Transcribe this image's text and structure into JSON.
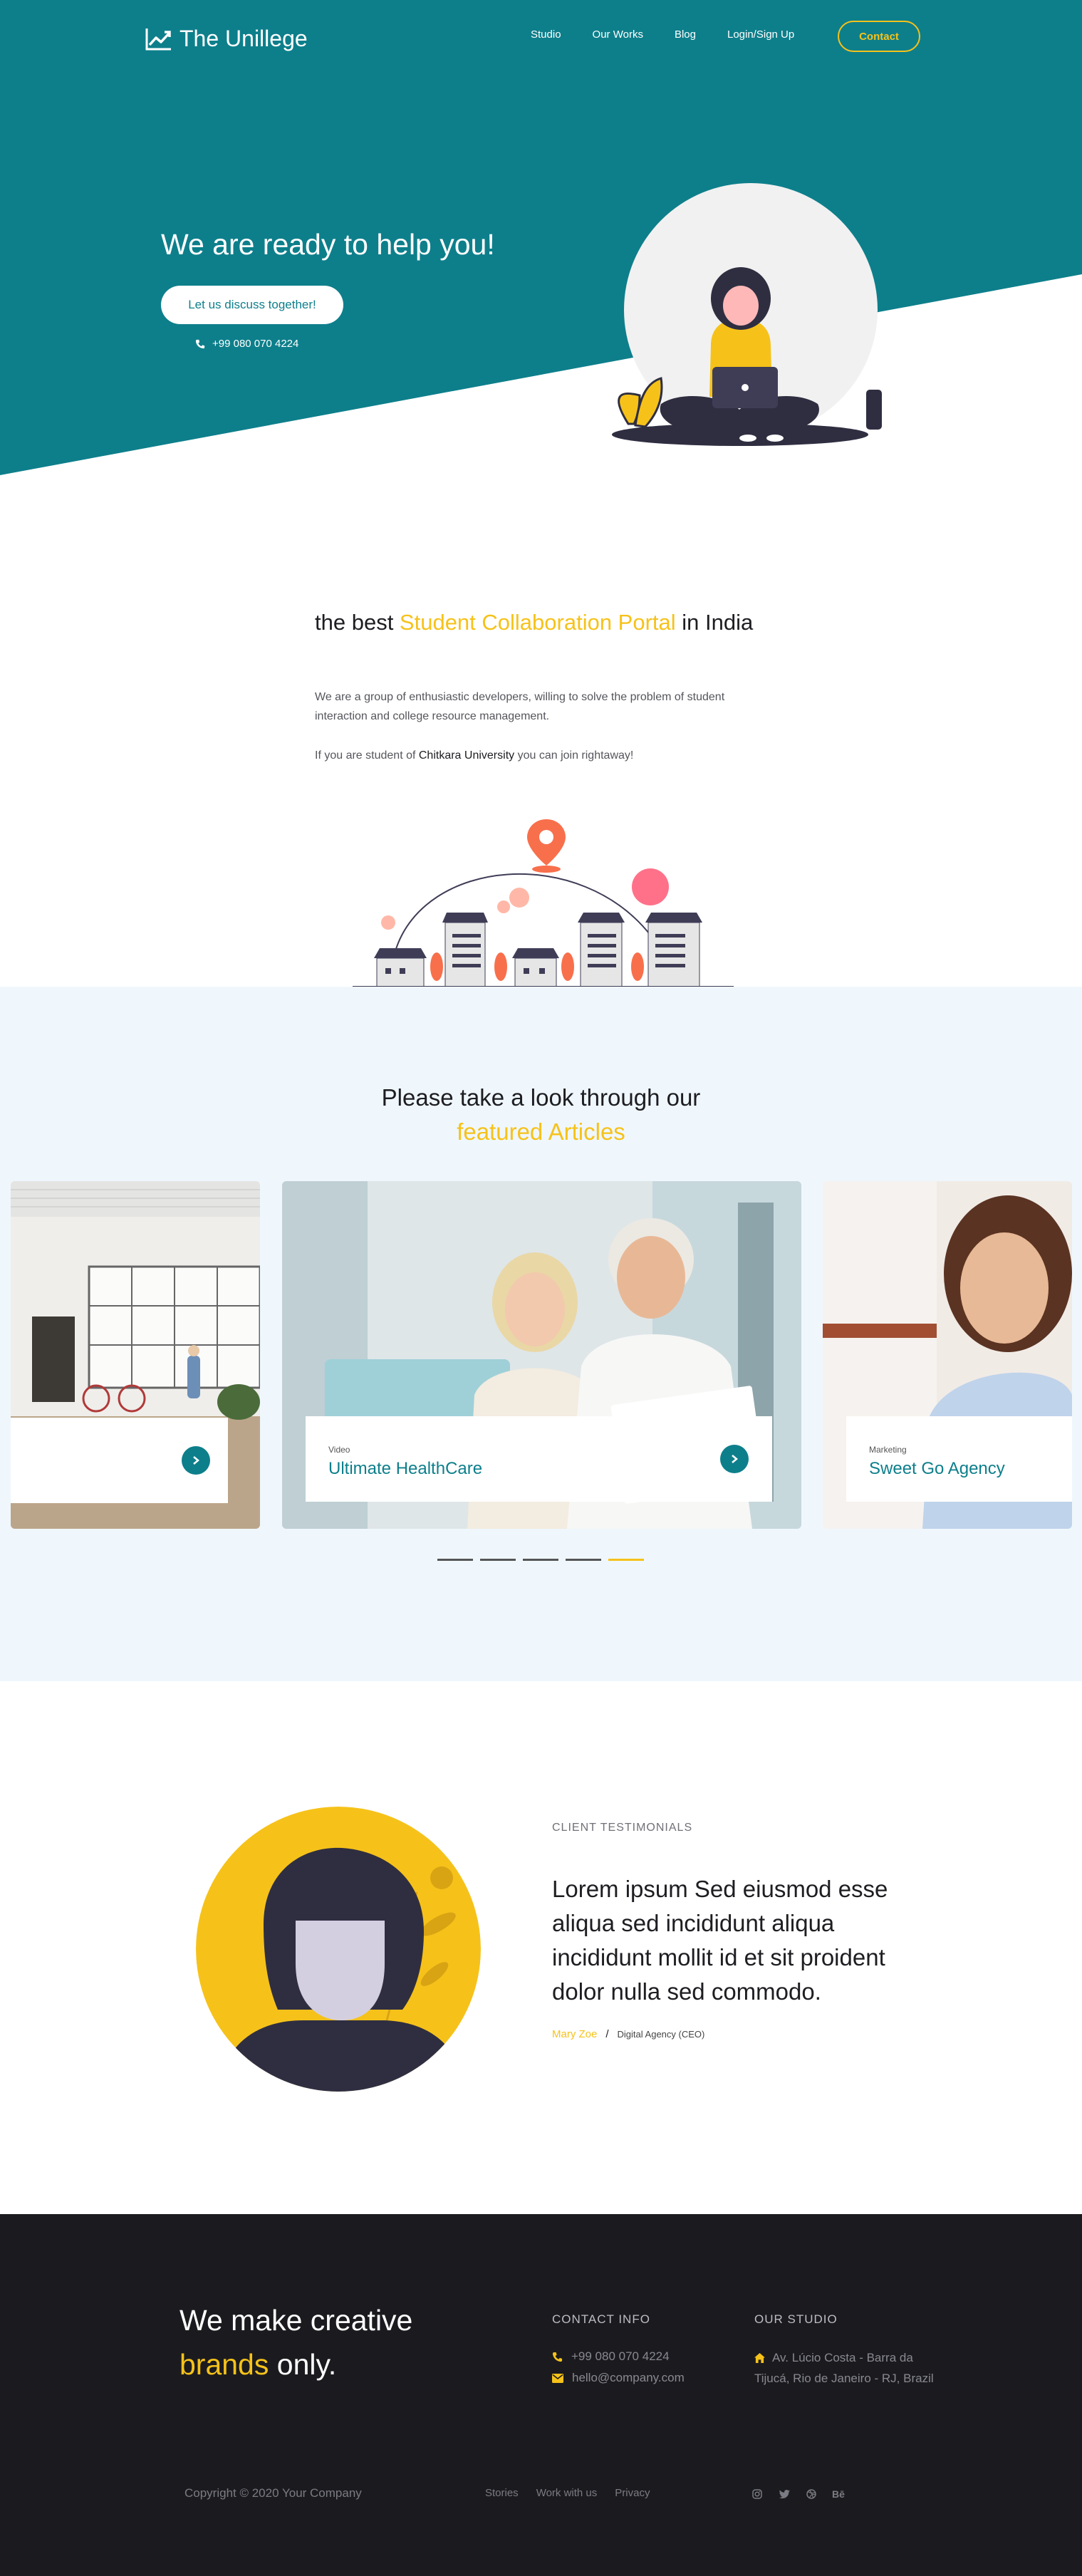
{
  "nav": {
    "logo_text": "The Unillege",
    "links": [
      "Studio",
      "Our Works",
      "Blog",
      "Login/Sign Up"
    ],
    "contact_label": "Contact"
  },
  "hero": {
    "title": "We are ready to help you!",
    "cta_label": "Let us discuss together!",
    "phone": "+99 080 070 4224"
  },
  "about": {
    "title_pre": "the best ",
    "title_accent": "Student Collaboration Portal",
    "title_post": " in India",
    "paragraph": "We are a group of enthusiastic developers, willing to solve the problem of student interaction and college resource management.",
    "join_pre": "If you are student of ",
    "join_bold": "Chitkara University",
    "join_post": " you can join rightaway!"
  },
  "articles": {
    "title_line1": "Please take a look through our",
    "title_line2": "featured Articles",
    "cards": [
      {
        "category": "",
        "title": ""
      },
      {
        "category": "Video",
        "title": "Ultimate HealthCare"
      },
      {
        "category": "Marketing",
        "title": "Sweet Go Agency"
      }
    ],
    "dots_count": 5,
    "active_dot": 4
  },
  "testimonials": {
    "kicker": "CLIENT TESTIMONIALS",
    "quote": "Lorem ipsum Sed eiusmod esse aliqua sed incididunt aliqua incididunt mollit id et sit proident dolor nulla sed commodo.",
    "author": "Mary Zoe",
    "separator": "/",
    "role": "Digital Agency (CEO)"
  },
  "footer": {
    "slogan_line1": "We make creative",
    "slogan_accent": "brands",
    "slogan_post": " only.",
    "contact_title": "CONTACT INFO",
    "phone": "+99 080 070 4224",
    "email": "hello@company.com",
    "studio_title": "OUR STUDIO",
    "address": "Av. Lúcio Costa - Barra da Tijucá, Rio de Janeiro - RJ, Brazil",
    "copyright": "Copyright © 2020 Your Company",
    "links": [
      "Stories",
      "Work with us",
      "Privacy"
    ],
    "socials": [
      "instagram-icon",
      "twitter-icon",
      "dribbble-icon",
      "behance-icon"
    ],
    "behance_label": "Bē"
  },
  "colors": {
    "teal": "#0d7f8b",
    "yellow": "#f6c21a",
    "dark": "#1b1b1f",
    "light_blue": "#eff7fd"
  }
}
